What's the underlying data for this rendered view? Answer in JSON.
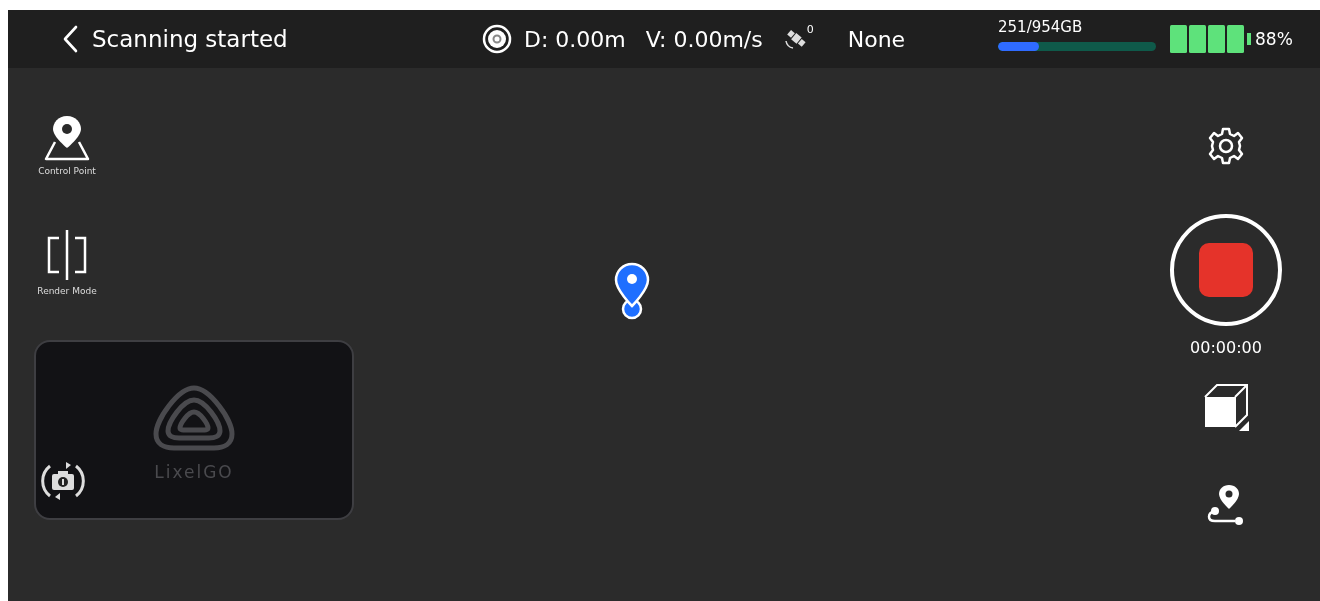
{
  "top_bar": {
    "title": "Scanning started",
    "distance": "D: 0.00m",
    "velocity": "V: 0.00m/s",
    "satellites": "0",
    "fix_status": "None",
    "storage": {
      "text": "251/954GB",
      "level": 0.26
    },
    "battery": "88%"
  },
  "left_tools": [
    {
      "kind": "control-point",
      "label": "Control Point"
    },
    {
      "kind": "render-mode",
      "label": "Render Mode"
    }
  ],
  "preview": {
    "logo_text": "LixelGO"
  },
  "record": {
    "recording": true,
    "timer": "00:00:00"
  }
}
